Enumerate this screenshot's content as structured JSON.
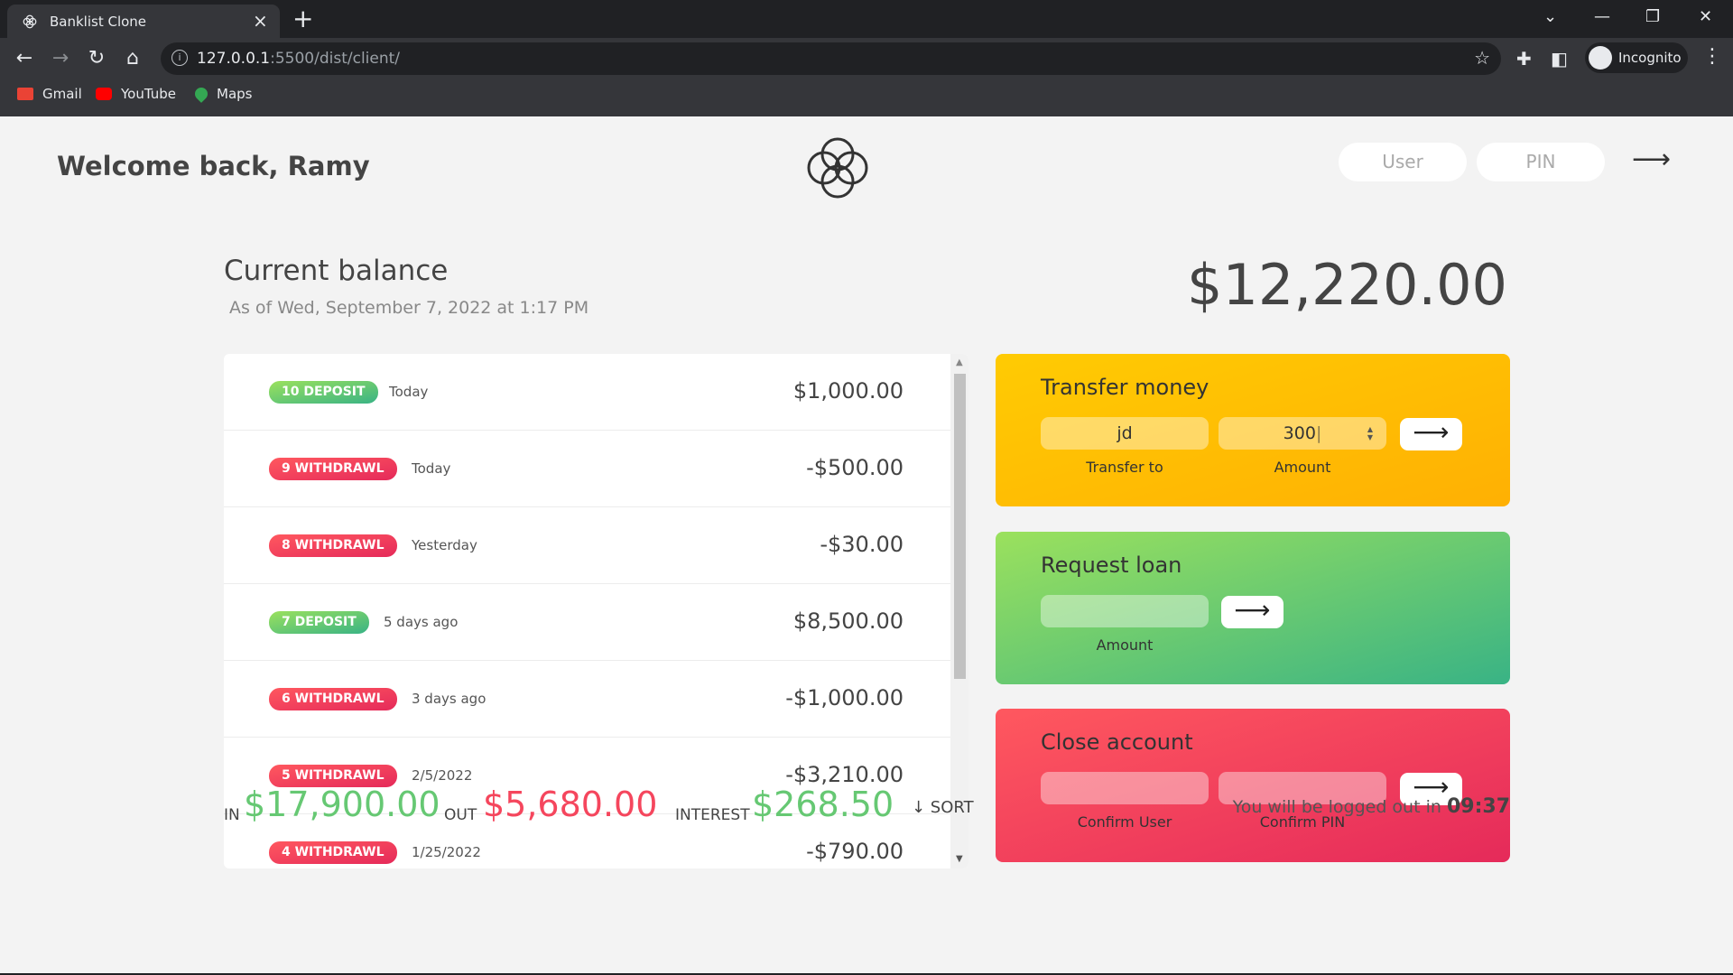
{
  "browser": {
    "tab_title": "Banklist Clone",
    "url_host": "127.0.0.1",
    "url_path": ":5500/dist/client/",
    "profile_label": "Incognito",
    "bookmarks": [
      "Gmail",
      "YouTube",
      "Maps"
    ]
  },
  "header": {
    "welcome": "Welcome back, Ramy",
    "user_placeholder": "User",
    "pin_placeholder": "PIN"
  },
  "balance": {
    "title": "Current balance",
    "date": "As of Wed, September 7, 2022 at 1:17 PM",
    "value": "$12,220.00"
  },
  "movements": [
    {
      "type": "10 deposit",
      "kind": "deposit",
      "date": "Today",
      "value": "$1,000.00"
    },
    {
      "type": "9 withdrawl",
      "kind": "withdrawal",
      "date": "Today",
      "value": "-$500.00"
    },
    {
      "type": "8 withdrawl",
      "kind": "withdrawal",
      "date": "Yesterday",
      "value": "-$30.00"
    },
    {
      "type": "7 deposit",
      "kind": "deposit",
      "date": "5 days ago",
      "value": "$8,500.00"
    },
    {
      "type": "6 withdrawl",
      "kind": "withdrawal",
      "date": "3 days ago",
      "value": "-$1,000.00"
    },
    {
      "type": "5 withdrawl",
      "kind": "withdrawal",
      "date": "2/5/2022",
      "value": "-$3,210.00"
    },
    {
      "type": "4 withdrawl",
      "kind": "withdrawal",
      "date": "1/25/2022",
      "value": "-$790.00"
    }
  ],
  "transfer": {
    "title": "Transfer money",
    "to_value": "jd",
    "amount_value": "300",
    "to_label": "Transfer to",
    "amount_label": "Amount"
  },
  "loan": {
    "title": "Request loan",
    "amount_label": "Amount"
  },
  "close": {
    "title": "Close account",
    "user_label": "Confirm User",
    "pin_label": "Confirm PIN"
  },
  "summary": {
    "in_label": "IN",
    "in_value": "$17,900.00",
    "out_label": "OUT",
    "out_value": "$5,680.00",
    "interest_label": "INTEREST",
    "interest_value": "$268.50",
    "sort_label": "↓ SORT"
  },
  "timer": {
    "prefix": "You will be logged out in",
    "value": "09:37"
  },
  "colors": {
    "deposit": "#66c873",
    "withdrawal": "#f5465d",
    "transfer": "#ffbb03",
    "loan": "#5ec576",
    "close": "#f0405f"
  }
}
